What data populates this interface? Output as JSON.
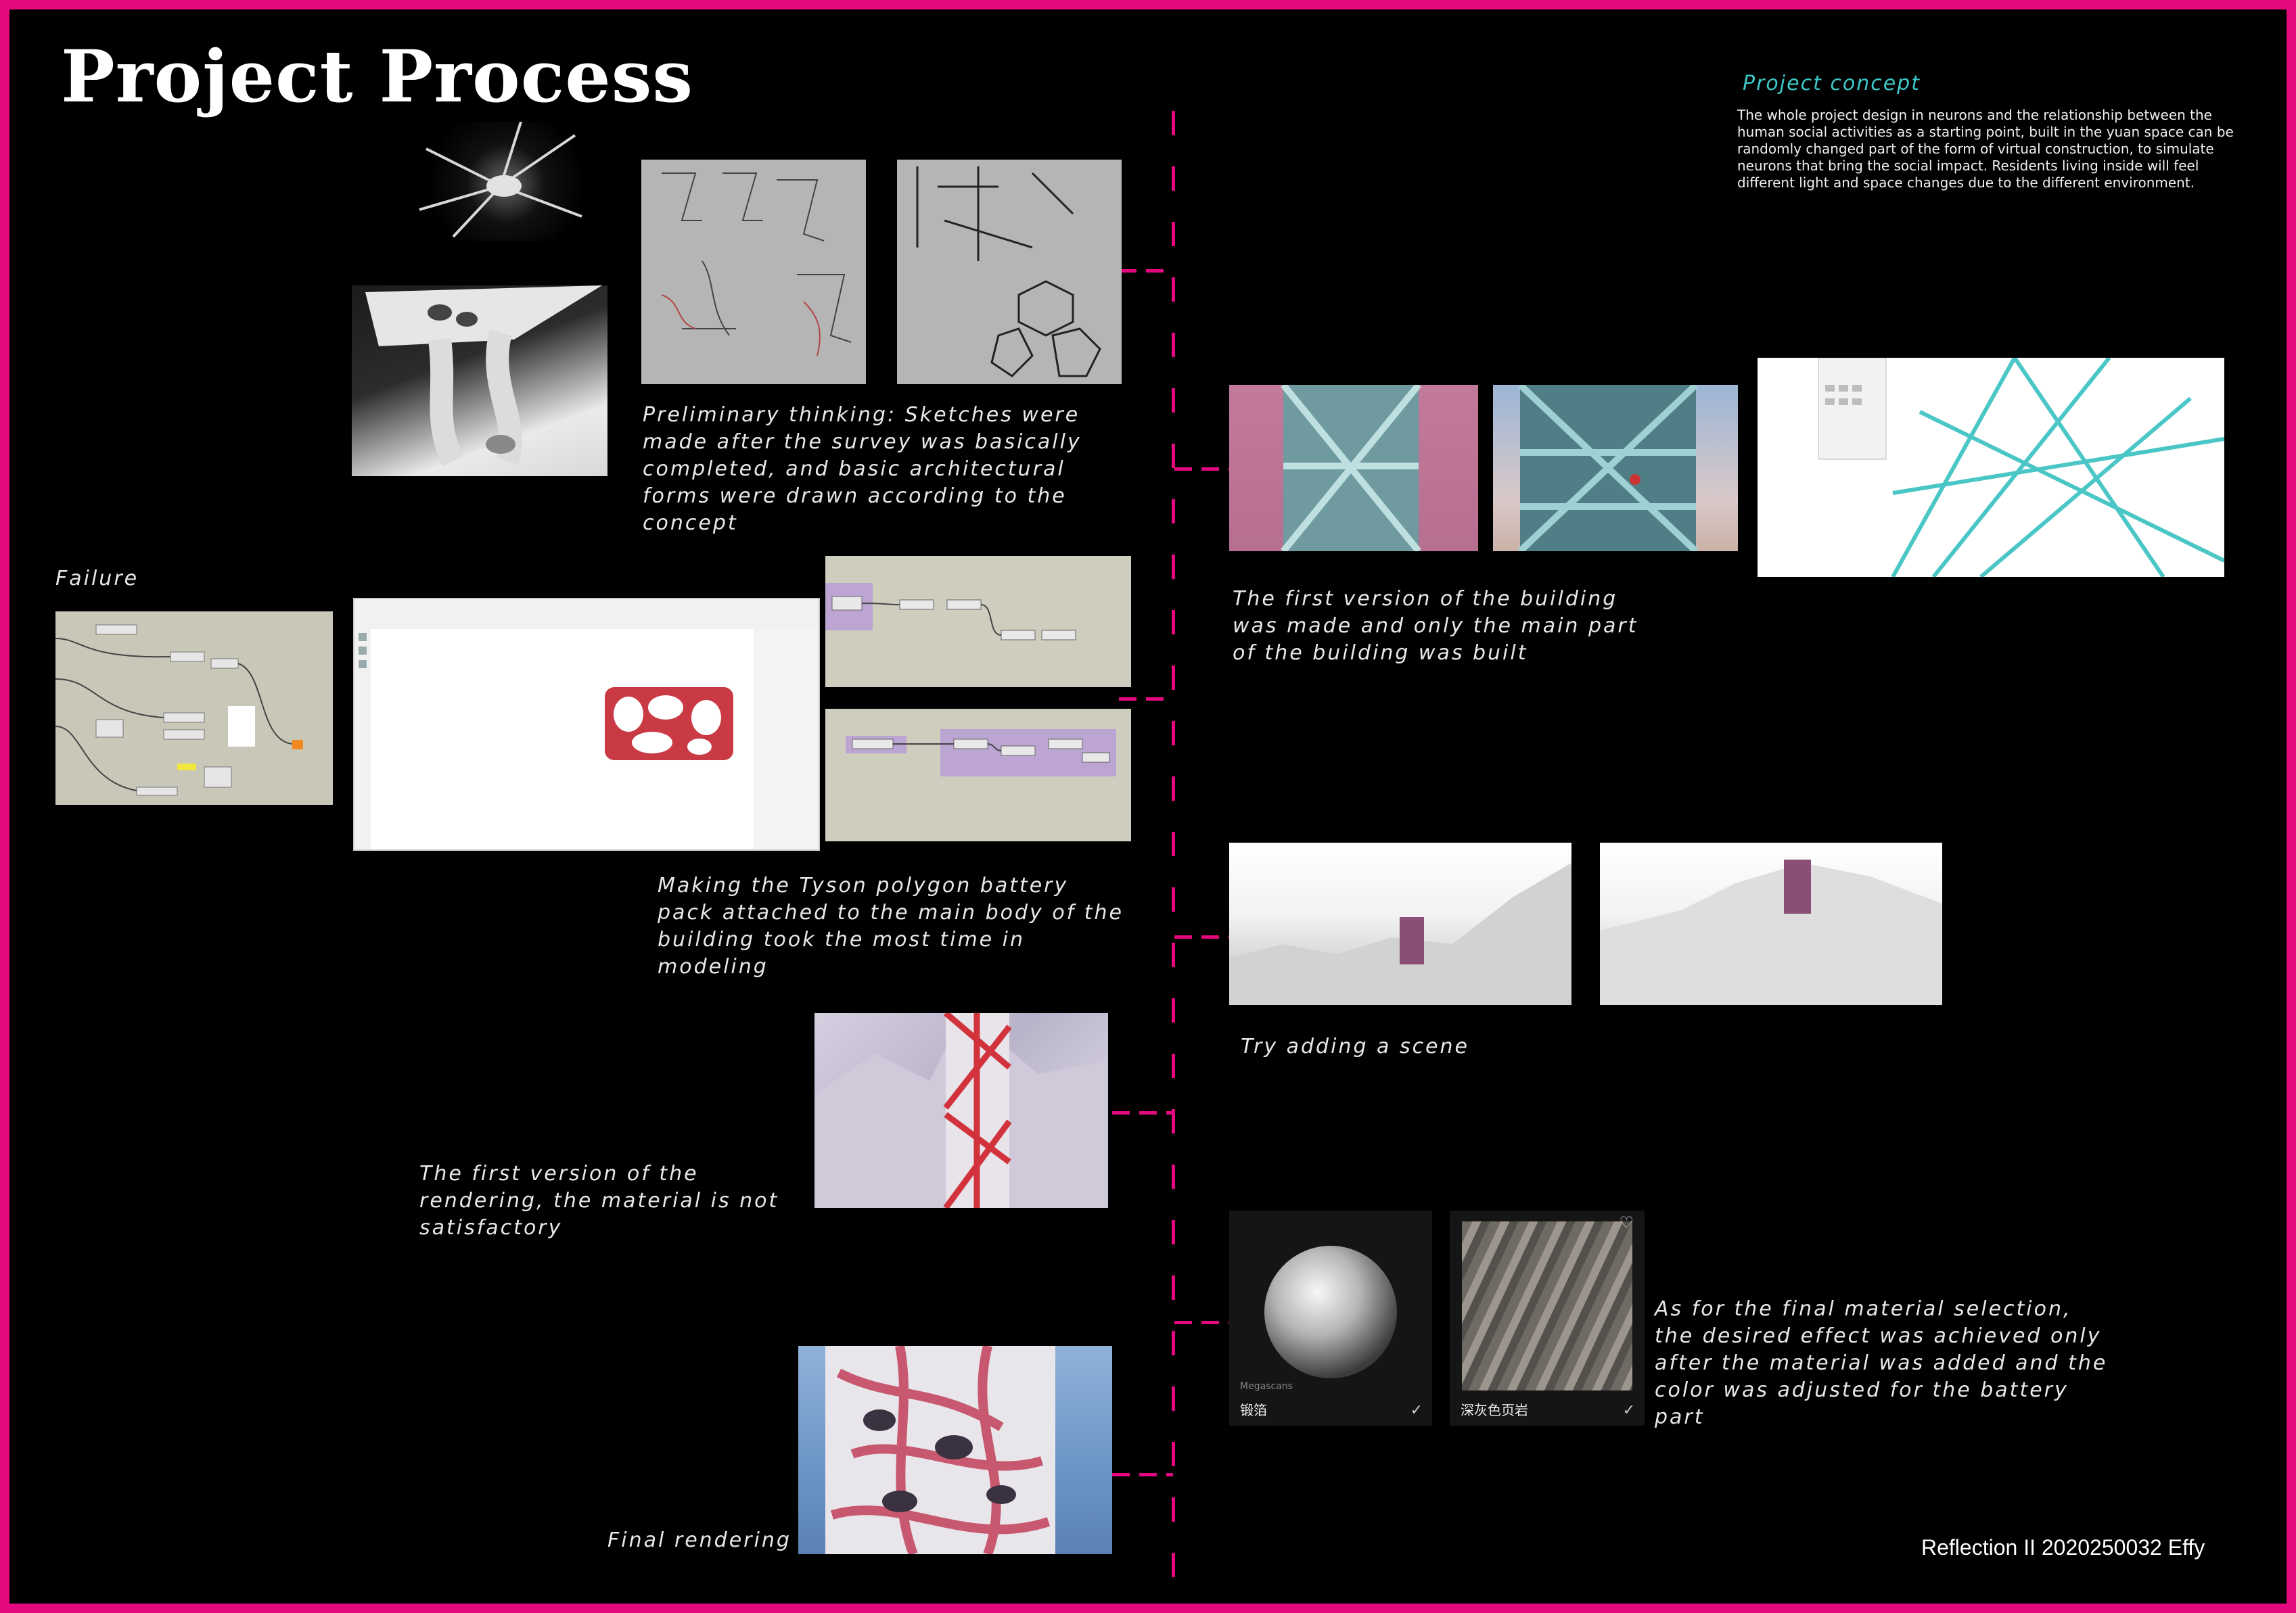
{
  "title": "Project Process",
  "concept": {
    "heading": "Project concept",
    "body": "The whole project design in neurons and the relationship between the human social activities as a starting point, built in the yuan space can be randomly changed part of the form of virtual construction, to simulate neurons that bring the social impact. Residents living inside will feel different light and space changes due to the different environment."
  },
  "captions": {
    "preliminary": "Preliminary thinking: Sketches were made after the survey was basically completed, and basic architectural forms were drawn according to the concept",
    "failure": "Failure",
    "first_version": "The first version of the building was made and only the main part of the building was built",
    "tyson": "Making the Tyson polygon battery pack attached to the main body of the building took the most time in modeling",
    "scene": "Try adding a scene",
    "render1": "The first version of the rendering, the material is not satisfactory",
    "material": "As for the final material selection, the desired effect was achieved only after the material was added and the color was adjusted for the battery part",
    "final": "Final rendering"
  },
  "materials": {
    "silver_label": "锻箔",
    "stone_label": "深灰色页岩",
    "watermark": "Megascans"
  },
  "footer": "Reflection II  2020250032  Effy",
  "colors": {
    "frame": "#e4097f",
    "background": "#000000",
    "concept_heading": "#3ec8c8"
  }
}
